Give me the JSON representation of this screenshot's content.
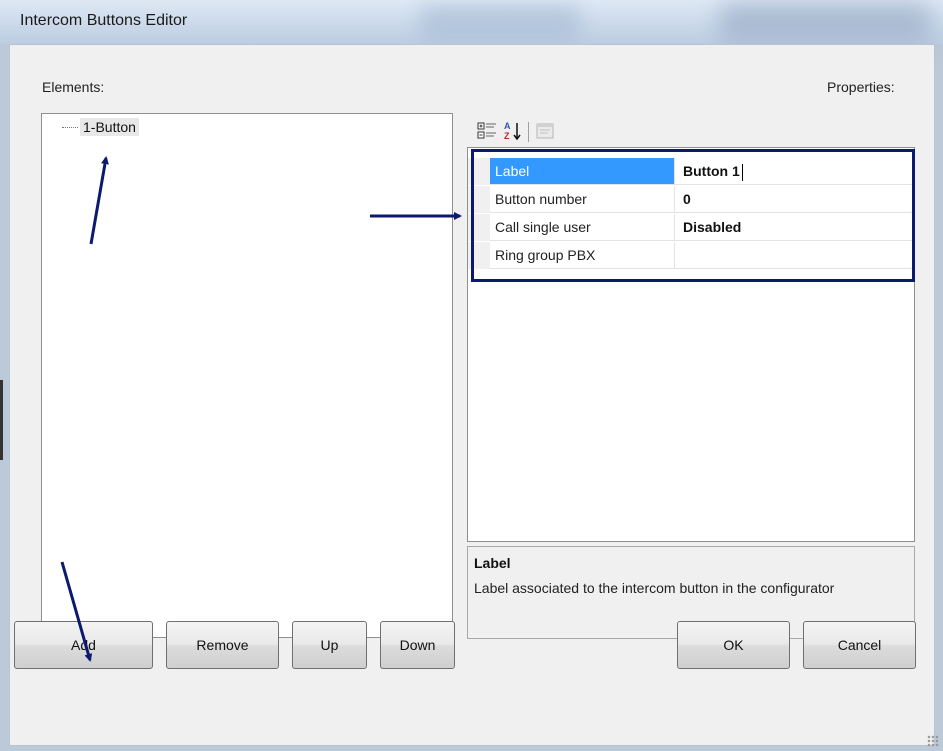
{
  "window": {
    "title": "Intercom Buttons Editor"
  },
  "labels": {
    "elements": "Elements:",
    "properties": "Properties:"
  },
  "tree": {
    "items": [
      {
        "label": "1-Button"
      }
    ]
  },
  "toolbar": {
    "items": [
      "categorized-icon",
      "alphabetical-sort-icon",
      "property-pages-icon"
    ]
  },
  "properties": [
    {
      "name": "Label",
      "value": "Button 1"
    },
    {
      "name": "Button number",
      "value": "0"
    },
    {
      "name": "Call single user",
      "value": "Disabled"
    },
    {
      "name": "Ring group PBX",
      "value": ""
    }
  ],
  "description": {
    "title": "Label",
    "text": "Label associated to the intercom button in the configurator"
  },
  "buttons": {
    "add": "Add",
    "remove": "Remove",
    "up": "Up",
    "down": "Down",
    "ok": "OK",
    "cancel": "Cancel"
  },
  "colors": {
    "selection": "#3399ff",
    "annotation": "#0b1a6e"
  }
}
